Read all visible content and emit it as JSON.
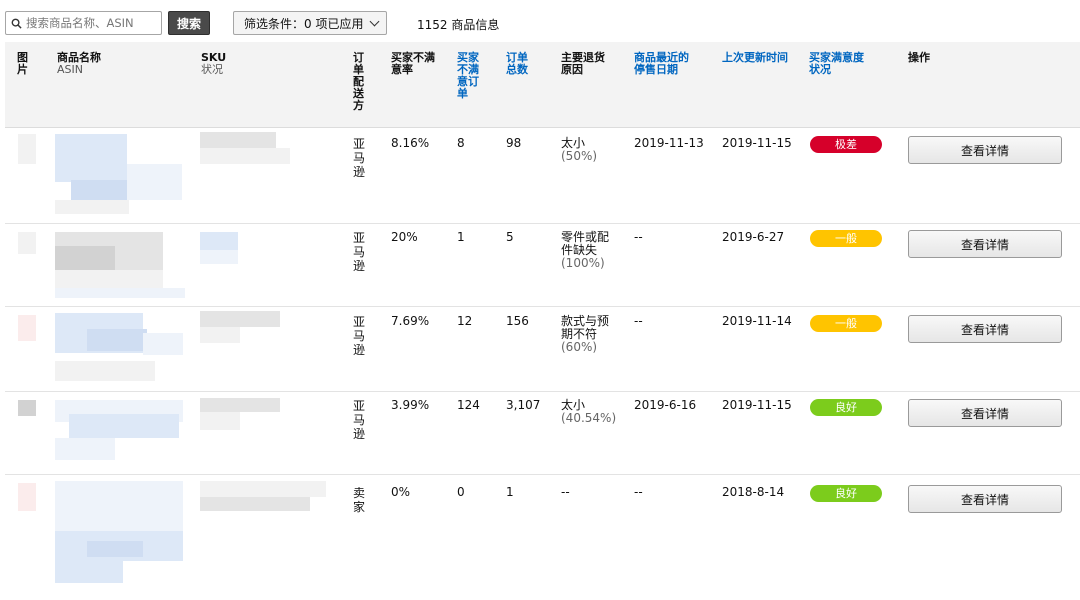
{
  "toolbar": {
    "search_placeholder": "搜索商品名称、ASIN",
    "search_button": "搜索",
    "filter_label": "筛选条件：0 项已应用",
    "result_count": "1152 商品信息"
  },
  "columns": {
    "image": "图片",
    "name": "商品名称",
    "name_sub": "ASIN",
    "sku": "SKU",
    "sku_sub": "状况",
    "fulfillment": "订单配送方",
    "rate": "买家不满意率",
    "dissatisfied_orders": "买家不满意订单",
    "total_orders": "订单总数",
    "return_reason": "主要退货原因",
    "last_stop_date": "商品最近的停售日期",
    "last_updated": "上次更新时间",
    "satisfaction": "买家满意度状况",
    "action": "操作"
  },
  "rows": [
    {
      "fulfillment": "亚马逊",
      "rate": "8.16%",
      "dissatisfied": "8",
      "total": "98",
      "reason": "太小",
      "reason_pct": "(50%)",
      "stop_date": "2019-11-13",
      "updated": "2019-11-15",
      "status": "极差",
      "status_color": "#d6002a",
      "action": "查看详情"
    },
    {
      "fulfillment": "亚马逊",
      "rate": "20%",
      "dissatisfied": "1",
      "total": "5",
      "reason": "零件或配件缺失",
      "reason_pct": "(100%)",
      "stop_date": "--",
      "updated": "2019-6-27",
      "status": "一般",
      "status_color": "#ffc400",
      "action": "查看详情"
    },
    {
      "fulfillment": "亚马逊",
      "rate": "7.69%",
      "dissatisfied": "12",
      "total": "156",
      "reason": "款式与预期不符",
      "reason_pct": "(60%)",
      "stop_date": "--",
      "updated": "2019-11-14",
      "status": "一般",
      "status_color": "#ffc400",
      "action": "查看详情"
    },
    {
      "fulfillment": "亚马逊",
      "rate": "3.99%",
      "dissatisfied": "124",
      "total": "3,107",
      "reason": "太小",
      "reason_pct": "(40.54%)",
      "stop_date": "2019-6-16",
      "updated": "2019-11-15",
      "status": "良好",
      "status_color": "#7ccc1c",
      "action": "查看详情"
    },
    {
      "fulfillment": "卖家",
      "rate": "0%",
      "dissatisfied": "0",
      "total": "1",
      "reason": "--",
      "reason_pct": "",
      "stop_date": "--",
      "updated": "2018-8-14",
      "status": "良好",
      "status_color": "#7ccc1c",
      "action": "查看详情"
    }
  ]
}
